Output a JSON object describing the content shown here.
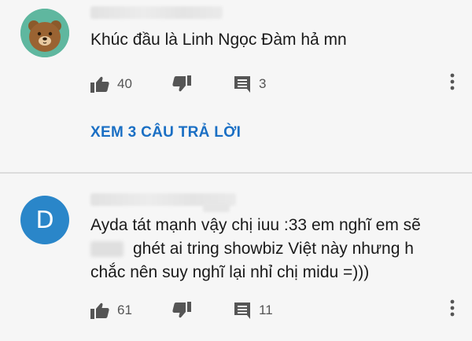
{
  "comments": [
    {
      "avatar_icon": "bear-avatar-icon",
      "text": "Khúc đầu là Linh Ngọc Đàm hả mn",
      "likes": "40",
      "replies_count": "3",
      "view_replies": "XEM 3 CÂU TRẢ LỜI"
    },
    {
      "avatar_letter": "D",
      "text_line1": "Ayda tát mạnh vậy chị iuu :33 em nghĩ em sẽ",
      "text_line2": "ghét ai tring showbiz Việt này nhưng h",
      "text_line3": "chắc nên suy nghĩ lại nhỉ chị midu =)))",
      "likes": "61",
      "replies_count": "11"
    }
  ],
  "colors": {
    "background": "#f6f6f6",
    "link": "#1a6fc4",
    "avatar_green": "#5fb79f",
    "avatar_blue": "#2a86c9",
    "icon": "#555555"
  }
}
